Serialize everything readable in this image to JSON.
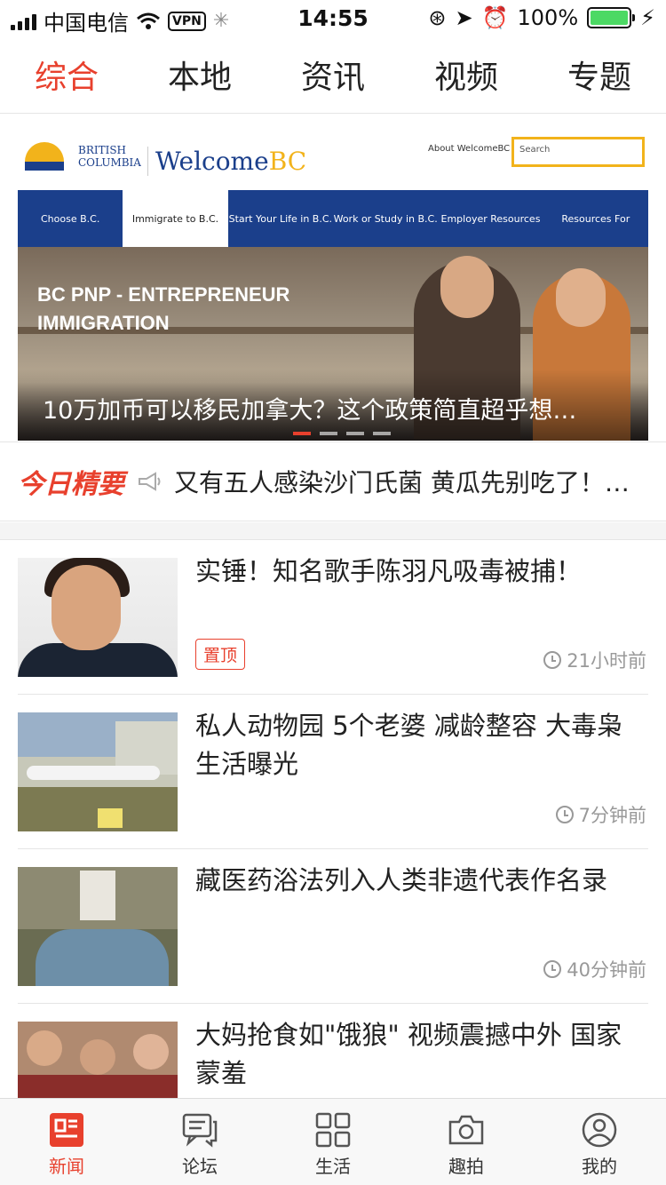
{
  "status": {
    "carrier": "中国电信",
    "vpn": "VPN",
    "time": "14:55",
    "battery": "100%"
  },
  "tabs": [
    "综合",
    "本地",
    "资讯",
    "视频",
    "专题"
  ],
  "banner": {
    "site_logo_text_line1": "BRITISH",
    "site_logo_text_line2": "COLUMBIA",
    "site_name_a": "Welcome",
    "site_name_b": "BC",
    "about_link": "About WelcomeBC",
    "search_placeholder": "Search",
    "nav": [
      "Choose B.C.",
      "Immigrate to B.C.",
      "Start Your Life in B.C.",
      "Work or Study in B.C.",
      "Employer Resources",
      "Resources For"
    ],
    "photo_text_line1": "BC PNP - ENTREPRENEUR",
    "photo_text_line2": "IMMIGRATION",
    "caption": "10万加币可以移民加拿大？这个政策简直超乎想…",
    "slide_count": 4,
    "active_slide": 1
  },
  "today": {
    "label": "今日精要",
    "text": "又有五人感染沙门氏菌 黄瓜先别吃了！…"
  },
  "news": [
    {
      "title": "实锤！知名歌手陈羽凡吸毒被捕！",
      "pinned_label": "置顶",
      "time": "21小时前"
    },
    {
      "title": "私人动物园 5个老婆 减龄整容 大毒枭生活曝光",
      "time": "7分钟前"
    },
    {
      "title": "藏医药浴法列入人类非遗代表作名录",
      "time": "40分钟前"
    },
    {
      "title": "大妈抢食如\"饿狼\" 视频震撼中外 国家蒙羞"
    }
  ],
  "bottom_nav": [
    "新闻",
    "论坛",
    "生活",
    "趣拍",
    "我的"
  ],
  "colors": {
    "accent": "#e8402d",
    "battery": "#4cd964",
    "bc_blue": "#1b3f8b",
    "bc_gold": "#f2b31b"
  }
}
